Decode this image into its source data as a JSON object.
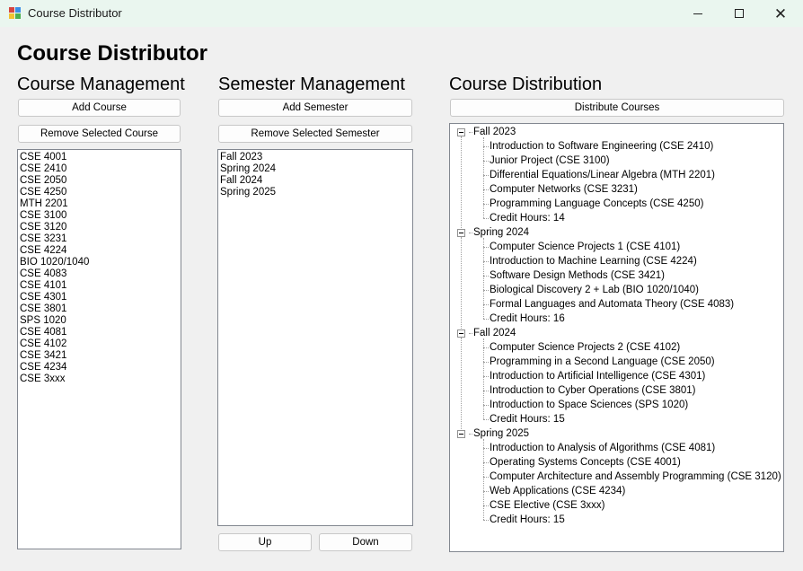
{
  "window": {
    "title": "Course Distributor",
    "minimize_icon": "minimize-icon",
    "maximize_icon": "maximize-icon",
    "close_glyph": "✕"
  },
  "heading": "Course Distributor",
  "course_management": {
    "title": "Course Management",
    "add_label": "Add Course",
    "remove_label": "Remove Selected Course",
    "courses": [
      "CSE 4001",
      "CSE 2410",
      "CSE 2050",
      "CSE 4250",
      "MTH 2201",
      "CSE 3100",
      "CSE 3120",
      "CSE 3231",
      "CSE 4224",
      "BIO 1020/1040",
      "CSE 4083",
      "CSE 4101",
      "CSE 4301",
      "CSE 3801",
      "SPS 1020",
      "CSE 4081",
      "CSE 4102",
      "CSE 3421",
      "CSE 4234",
      "CSE 3xxx"
    ]
  },
  "semester_management": {
    "title": "Semester Management",
    "add_label": "Add Semester",
    "remove_label": "Remove Selected Semester",
    "semesters": [
      "Fall 2023",
      "Spring 2024",
      "Fall 2024",
      "Spring 2025"
    ],
    "up_label": "Up",
    "down_label": "Down"
  },
  "course_distribution": {
    "title": "Course Distribution",
    "distribute_label": "Distribute Courses",
    "tree": [
      {
        "semester": "Fall 2023",
        "items": [
          "Introduction to Software Engineering (CSE 2410)",
          "Junior Project (CSE 3100)",
          "Differential Equations/Linear Algebra (MTH 2201)",
          "Computer Networks (CSE 3231)",
          "Programming Language Concepts (CSE 4250)",
          "Credit Hours: 14"
        ]
      },
      {
        "semester": "Spring 2024",
        "items": [
          "Computer Science Projects 1 (CSE 4101)",
          "Introduction to Machine Learning (CSE 4224)",
          "Software Design Methods (CSE 3421)",
          "Biological Discovery 2 + Lab (BIO 1020/1040)",
          "Formal Languages and Automata Theory (CSE 4083)",
          "Credit Hours: 16"
        ]
      },
      {
        "semester": "Fall 2024",
        "items": [
          "Computer Science Projects 2 (CSE 4102)",
          "Programming in a Second Language (CSE 2050)",
          "Introduction to Artificial Intelligence (CSE 4301)",
          "Introduction to Cyber Operations (CSE 3801)",
          "Introduction to Space Sciences (SPS 1020)",
          "Credit Hours: 15"
        ]
      },
      {
        "semester": "Spring 2025",
        "items": [
          "Introduction to Analysis of Algorithms (CSE 4081)",
          "Operating Systems Concepts (CSE 4001)",
          "Computer Architecture and Assembly Programming (CSE 3120)",
          "Web Applications (CSE 4234)",
          "CSE Elective (CSE 3xxx)",
          "Credit Hours: 15"
        ]
      }
    ]
  }
}
